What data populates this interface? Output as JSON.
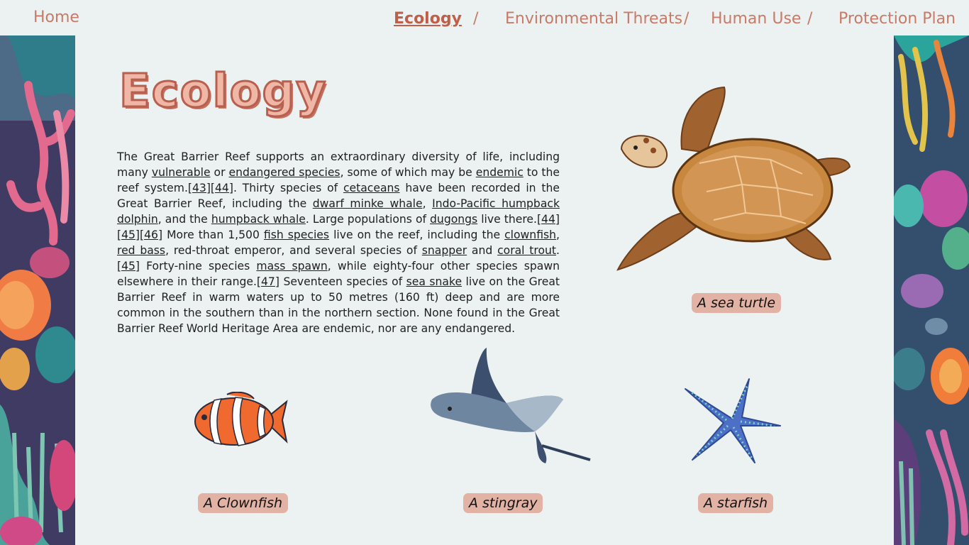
{
  "nav": {
    "home": "Home",
    "items": [
      "Ecology",
      "Environmental Threats",
      "Human Use",
      "Protection Plan"
    ],
    "separator": "/"
  },
  "page": {
    "title": "Ecology",
    "para": {
      "t1": "The Great Barrier Reef supports an extraordinary diversity of life, including many ",
      "l1": "vulnerable",
      "t2": " or ",
      "l2": "endangered species",
      "t3": ", some of which may be ",
      "l3": "endemic",
      "t4": " to the reef system.",
      "r1": "[43]",
      "r2": "[44]",
      "t5": ". Thirty species of ",
      "l4": "cetaceans",
      "t6": " have been recorded in the Great Barrier Reef, including the ",
      "l5": "dwarf minke whale",
      "t7": ", ",
      "l6": "Indo-Pacific humpback dolphin",
      "t8": ", and the ",
      "l7": "humpback whale",
      "t9": ". Large populations of ",
      "l8": "dugongs",
      "t10": " live there.",
      "r3": "[44]",
      "r4": "[45]",
      "r5": "[46]",
      "t11": " More than 1,500 ",
      "l9": "fish species",
      "t12": " live on the reef, including the ",
      "l10": "clownfish",
      "t13": ", ",
      "l11": "red bass",
      "t14": ", red-throat emperor, and several species of ",
      "l12": "snapper",
      "t15": " and ",
      "l13": "coral trout",
      "t16": ".",
      "r6": "[45]",
      "t17": " Forty-nine species ",
      "l14": "mass spawn",
      "t18": ", while eighty-four other species spawn elsewhere in their range.",
      "r7": "[47]",
      "t19": " Seventeen species of ",
      "l15": "sea snake",
      "t20": " live on the Great Barrier Reef in warm waters up to 50 metres (160 ft) deep and are more common in the southern than in the northern section. None found in the Great Barrier Reef World Heritage Area are endemic, nor are any endangered."
    },
    "captions": {
      "turtle": "A sea turtle",
      "clownfish": "A Clownfish",
      "stingray": "A stingray",
      "starfish": "A starfish"
    }
  },
  "colors": {
    "nav_text": "#c97a66",
    "caption_bg": "#e2b3a4",
    "page_bg": "#ecf2f2"
  }
}
